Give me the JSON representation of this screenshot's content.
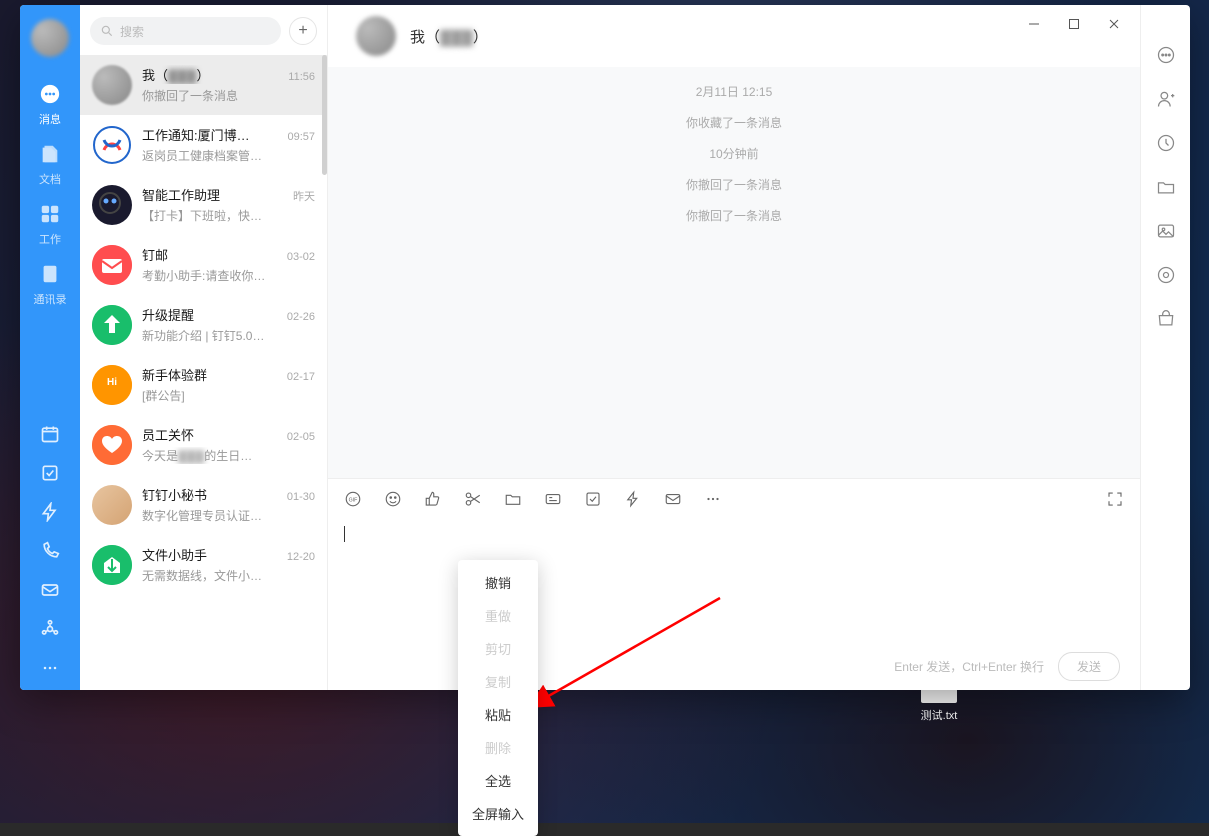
{
  "desktop": {
    "file_name": "测试.txt"
  },
  "search": {
    "placeholder": "搜索"
  },
  "nav": {
    "messages": "消息",
    "docs": "文档",
    "work": "工作",
    "contacts": "通讯录"
  },
  "conversations": [
    {
      "name_prefix": "我（",
      "name_blur": "▓▓▓",
      "name_suffix": "）",
      "time": "11:56",
      "preview": "你撤回了一条消息",
      "avatar_type": "blur",
      "active": true
    },
    {
      "name": "工作通知:厦门博…",
      "time": "09:57",
      "preview": "返岗员工健康档案管…",
      "avatar_bg": "#fff",
      "avatar_svg": "xiamen"
    },
    {
      "name": "智能工作助理",
      "time": "昨天",
      "preview": "【打卡】下班啦，快…",
      "avatar_bg": "#1a1a2e",
      "avatar_svg": "robot"
    },
    {
      "name": "钉邮",
      "time": "03-02",
      "preview": "考勤小助手:请查收你…",
      "avatar_bg": "#FF4D4F",
      "avatar_svg": "mail"
    },
    {
      "name": "升级提醒",
      "time": "02-26",
      "preview": "新功能介绍 | 钉钉5.0…",
      "avatar_bg": "#19BE6B",
      "avatar_svg": "arrow-up"
    },
    {
      "name": "新手体验群",
      "time": "02-17",
      "preview": "[群公告]",
      "avatar_bg": "#FF9500",
      "avatar_svg": "hi"
    },
    {
      "name": "员工关怀",
      "time": "02-05",
      "preview_prefix": "今天是",
      "preview_blur": "▓▓▓",
      "preview_suffix": "的生日…",
      "avatar_bg": "#FF6B35",
      "avatar_svg": "heart"
    },
    {
      "name": "钉钉小秘书",
      "time": "01-30",
      "preview": "数字化管理专员认证…",
      "avatar_type": "photo"
    },
    {
      "name": "文件小助手",
      "time": "12-20",
      "preview": "无需数据线，文件小…",
      "avatar_bg": "#19BE6B",
      "avatar_svg": "file"
    }
  ],
  "chat": {
    "title_prefix": "我（",
    "title_blur": "▓▓▓",
    "title_suffix": "）",
    "messages": [
      "2月11日 12:15",
      "你收藏了一条消息",
      "10分钟前",
      "你撤回了一条消息",
      "你撤回了一条消息"
    ],
    "send_hint": "Enter 发送，Ctrl+Enter 换行",
    "send_btn": "发送"
  },
  "context_menu": [
    {
      "label": "撤销",
      "disabled": false
    },
    {
      "label": "重做",
      "disabled": true
    },
    {
      "label": "剪切",
      "disabled": true
    },
    {
      "label": "复制",
      "disabled": true
    },
    {
      "label": "粘贴",
      "disabled": false
    },
    {
      "label": "删除",
      "disabled": true
    },
    {
      "label": "全选",
      "disabled": false
    },
    {
      "label": "全屏输入",
      "disabled": false
    }
  ]
}
